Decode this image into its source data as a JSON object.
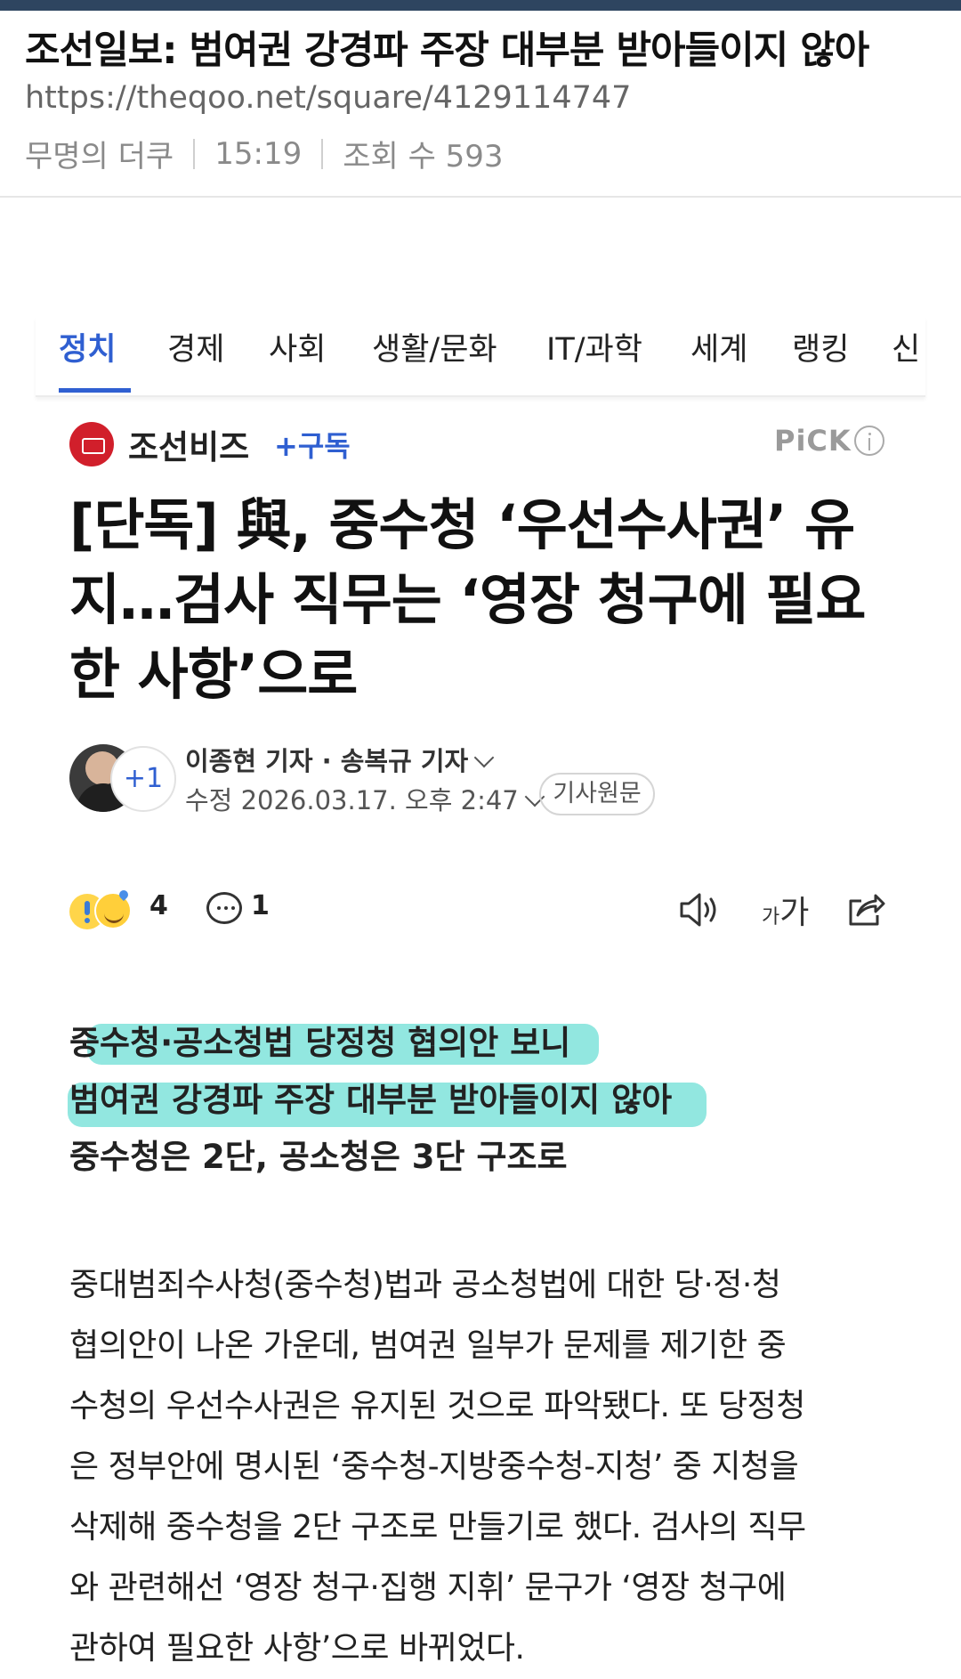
{
  "post": {
    "title": "조선일보: 범여권 강경파 주장 대부분 받아들이지 않아",
    "url": "https://theqoo.net/square/4129114747",
    "author": "무명의 더쿠",
    "time": "15:19",
    "views": "조회 수 593"
  },
  "tabs": [
    {
      "label": "정치",
      "active": true
    },
    {
      "label": "경제"
    },
    {
      "label": "사회"
    },
    {
      "label": "생활/문화"
    },
    {
      "label": "IT/과학"
    },
    {
      "label": "세계"
    },
    {
      "label": "랭킹"
    },
    {
      "label": "신"
    }
  ],
  "press": {
    "name": "조선비즈",
    "subscribe": "+구독",
    "pick": "PiCK"
  },
  "article": {
    "headline_lines": [
      "[단독] 與, 중수청 ‘우선수사권’ 유",
      "지…검사 직무는 ‘영장 청구에 필요",
      "한 사항’으로"
    ],
    "reporters": "이종현 기자 · 송복규 기자",
    "extra_reporters": "+1",
    "modified": "수정 2026.03.17. 오후 2:47",
    "original_button": "기사원문",
    "reaction_count": "4",
    "comment_count": "1",
    "font_size_label_small": "가",
    "font_size_label_large": "가",
    "subheads": [
      "중수청·공소청법 당정청 협의안 보니",
      "범여권 강경파 주장 대부분 받아들이지 않아",
      "중수청은 2단, 공소청은 3단 구조로"
    ],
    "body_lines": [
      "중대범죄수사청(중수청)법과 공소청법에 대한 당·정·청",
      "협의안이 나온 가운데, 범여권 일부가 문제를 제기한 중",
      "수청의 우선수사권은 유지된 것으로 파악됐다. 또 당정청",
      "은 정부안에 명시된 ‘중수청-지방중수청-지청’ 중 지청을",
      "삭제해 중수청을 2단 구조로 만들기로 했다. 검사의 직무",
      "와 관련해선 ‘영장 청구·집행 지휘’ 문구가 ‘영장 청구에",
      "관하여 필요한 사항’으로 바뀌었다."
    ]
  },
  "colors": {
    "accent": "#2f5fd1",
    "highlight": "#7fe3db",
    "press_logo": "#d11f2b"
  }
}
